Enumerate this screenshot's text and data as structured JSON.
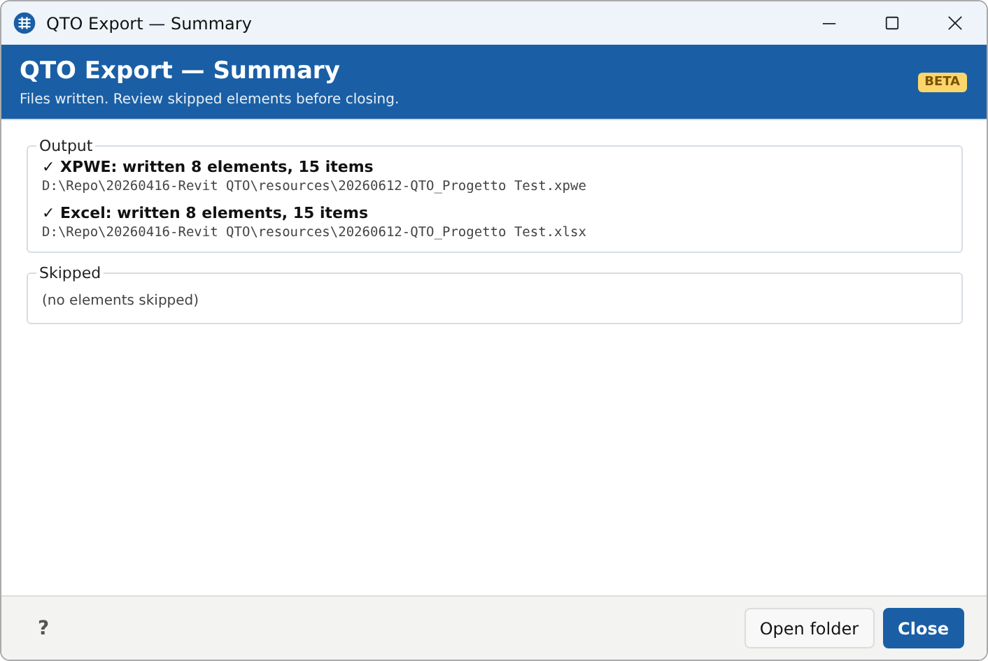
{
  "window": {
    "title": "QTO Export — Summary"
  },
  "header": {
    "title": "QTO Export — Summary",
    "subtitle": "Files written. Review skipped elements before closing.",
    "badge": "BETA"
  },
  "output": {
    "legend": "Output",
    "entries": [
      {
        "status": "✓ XPWE: written 8 elements, 15 items",
        "path": "D:\\Repo\\20260416-Revit QTO\\resources\\20260612-QTO_Progetto Test.xpwe"
      },
      {
        "status": "✓ Excel: written 8 elements, 15 items",
        "path": "D:\\Repo\\20260416-Revit QTO\\resources\\20260612-QTO_Progetto Test.xlsx"
      }
    ]
  },
  "skipped": {
    "legend": "Skipped",
    "message": "(no elements skipped)"
  },
  "footer": {
    "help": "?",
    "buttons": [
      {
        "label": "Open folder",
        "kind": "secondary"
      },
      {
        "label": "Close",
        "kind": "primary"
      }
    ]
  }
}
